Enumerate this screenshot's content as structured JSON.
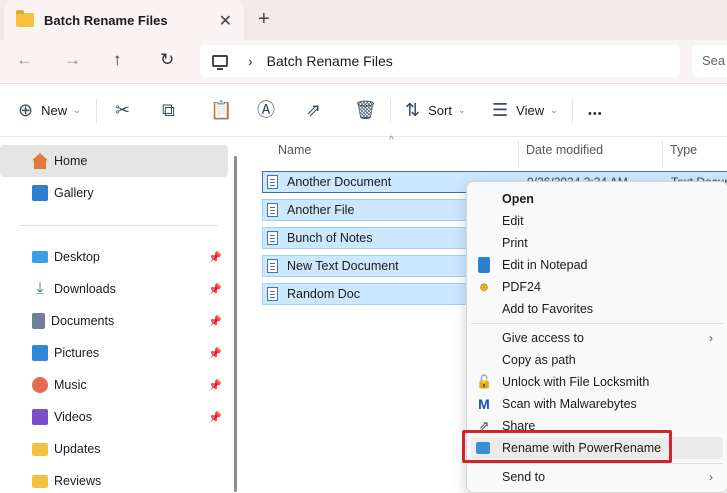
{
  "window": {
    "tab_title": "Batch Rename Files",
    "close_glyph": "✕",
    "new_tab_glyph": "+"
  },
  "addressbar": {
    "back_glyph": "←",
    "forward_glyph": "→",
    "up_glyph": "↑",
    "refresh_glyph": "↻",
    "chevron": "›",
    "breadcrumb": "Batch Rename Files",
    "search_fragment": "Sea"
  },
  "toolbar": {
    "new_label": "New",
    "sort_label": "Sort",
    "view_label": "View",
    "more_glyph": "•••",
    "dropdown_glyph": "⌄",
    "plus_glyph": "⊕",
    "cut_glyph": "✂",
    "copy_glyph": "⧉",
    "paste_glyph": "📋",
    "rename_glyph": "Ⓐ",
    "share_glyph": "⇗",
    "delete_glyph": "🗑",
    "sort_glyph": "⇅",
    "view_glyph": "☰"
  },
  "sidebar": {
    "pin_glyph": "📌",
    "items": [
      {
        "label": "Home",
        "icon": "home-icon",
        "color": "#e07a3a"
      },
      {
        "label": "Gallery",
        "icon": "gallery-icon",
        "color": "#2f7fd1"
      },
      {
        "label": "Desktop",
        "icon": "desktop-icon",
        "color": "#3aa0e6"
      },
      {
        "label": "Downloads",
        "icon": "downloads-icon",
        "color": "#2e8b57"
      },
      {
        "label": "Documents",
        "icon": "documents-icon",
        "color": "#6d7f9a"
      },
      {
        "label": "Pictures",
        "icon": "pictures-icon",
        "color": "#2f86d6"
      },
      {
        "label": "Music",
        "icon": "music-icon",
        "color": "#e46b4d"
      },
      {
        "label": "Videos",
        "icon": "videos-icon",
        "color": "#7b4fc9"
      },
      {
        "label": "Updates",
        "icon": "folder-icon",
        "color": "#f4c23f"
      },
      {
        "label": "Reviews",
        "icon": "folder-icon",
        "color": "#f4c23f"
      }
    ]
  },
  "columns": {
    "name": "Name",
    "date": "Date modified",
    "type": "Type",
    "sort_glyph": "^"
  },
  "files": [
    {
      "name": "Another Document",
      "date": "9/26/2024 2:34 AM",
      "type": "Text Document"
    },
    {
      "name": "Another File",
      "date": "",
      "type": ""
    },
    {
      "name": "Bunch of Notes",
      "date": "",
      "type": ""
    },
    {
      "name": "New Text Document",
      "date": "",
      "type": ""
    },
    {
      "name": "Random Doc",
      "date": "",
      "type": ""
    }
  ],
  "context_menu": {
    "submenu_glyph": "›",
    "items": [
      {
        "label": "Open",
        "bold": true,
        "icon": ""
      },
      {
        "label": "Edit",
        "icon": ""
      },
      {
        "label": "Print",
        "icon": ""
      },
      {
        "label": "Edit in Notepad",
        "icon": "notepad-icon"
      },
      {
        "label": "PDF24",
        "icon": "pdf24-icon"
      },
      {
        "label": "Add to Favorites",
        "icon": ""
      },
      {
        "label": "Give access to",
        "icon": "",
        "submenu": true
      },
      {
        "label": "Copy as path",
        "icon": ""
      },
      {
        "label": "Unlock with File Locksmith",
        "icon": "lock-icon"
      },
      {
        "label": "Scan with Malwarebytes",
        "icon": "malwarebytes-icon"
      },
      {
        "label": "Share",
        "icon": "share-icon"
      },
      {
        "label": "Rename with PowerRename",
        "icon": "powerrename-icon"
      },
      {
        "label": "Send to",
        "icon": "",
        "submenu": true
      }
    ]
  },
  "colors": {
    "selection_fill": "#cce8ff",
    "selection_border": "#99d1ff",
    "highlight_box": "#d3232a"
  }
}
